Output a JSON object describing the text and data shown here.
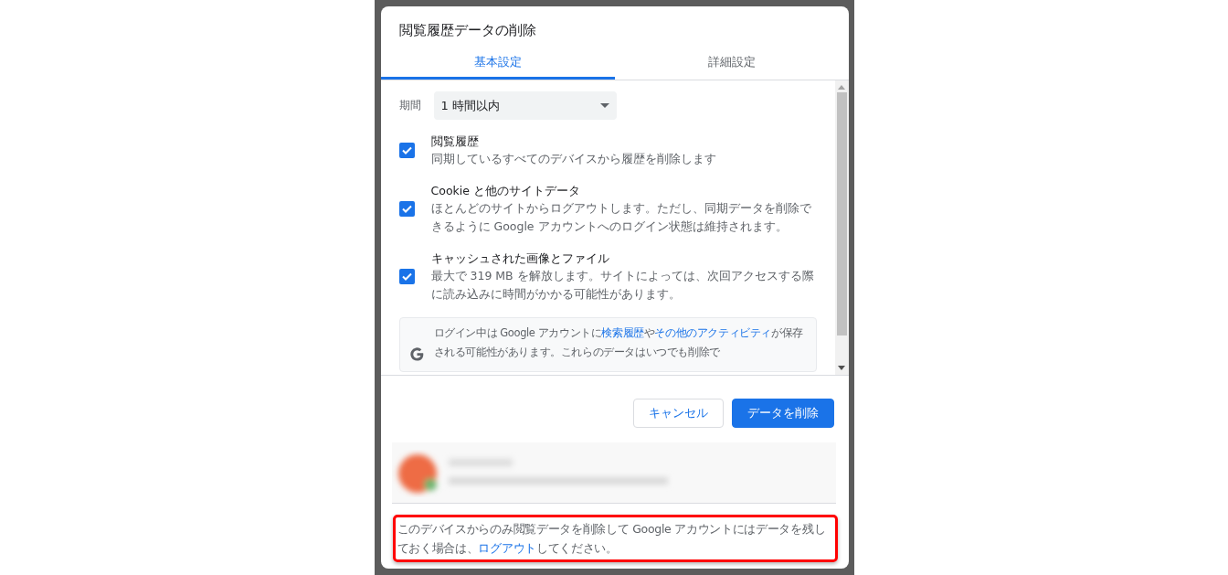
{
  "dialog": {
    "title": "閲覧履歴データの削除"
  },
  "tabs": [
    {
      "label": "基本設定",
      "selected": true
    },
    {
      "label": "詳細設定",
      "selected": false
    }
  ],
  "period": {
    "label": "期間",
    "value": "1 時間以内"
  },
  "options": [
    {
      "title": "閲覧履歴",
      "description": "同期しているすべてのデバイスから履歴を削除します",
      "checked": true
    },
    {
      "title": "Cookie と他のサイトデータ",
      "description": "ほとんどのサイトからログアウトします。ただし、同期データを削除できるように Google アカウントへのログイン状態は維持されます。",
      "checked": true
    },
    {
      "title": "キャッシュされた画像とファイル",
      "description": "最大で 319 MB を解放します。サイトによっては、次回アクセスする際に読み込みに時間がかかる可能性があります。",
      "checked": true
    }
  ],
  "info": {
    "parts": [
      {
        "text": "ログイン中は Google アカウントに",
        "link": false
      },
      {
        "text": "検索履歴",
        "link": true
      },
      {
        "text": "や",
        "link": false
      },
      {
        "text": "その他のアクティビティ",
        "link": true
      },
      {
        "text": "が保存される可能性があります。これらのデータはいつでも削除で",
        "link": false
      }
    ]
  },
  "buttons": [
    {
      "label": "キャンセル",
      "kind": "secondary"
    },
    {
      "label": "データを削除",
      "kind": "primary"
    }
  ],
  "footer_note": {
    "highlighted": true,
    "parts": [
      {
        "text": "このデバイスからのみ閲覧データを削除して Google アカウントにはデータを残しておく場合は、",
        "link": false
      },
      {
        "text": "ログアウト",
        "link": true
      },
      {
        "text": "してください。",
        "link": false
      }
    ]
  }
}
